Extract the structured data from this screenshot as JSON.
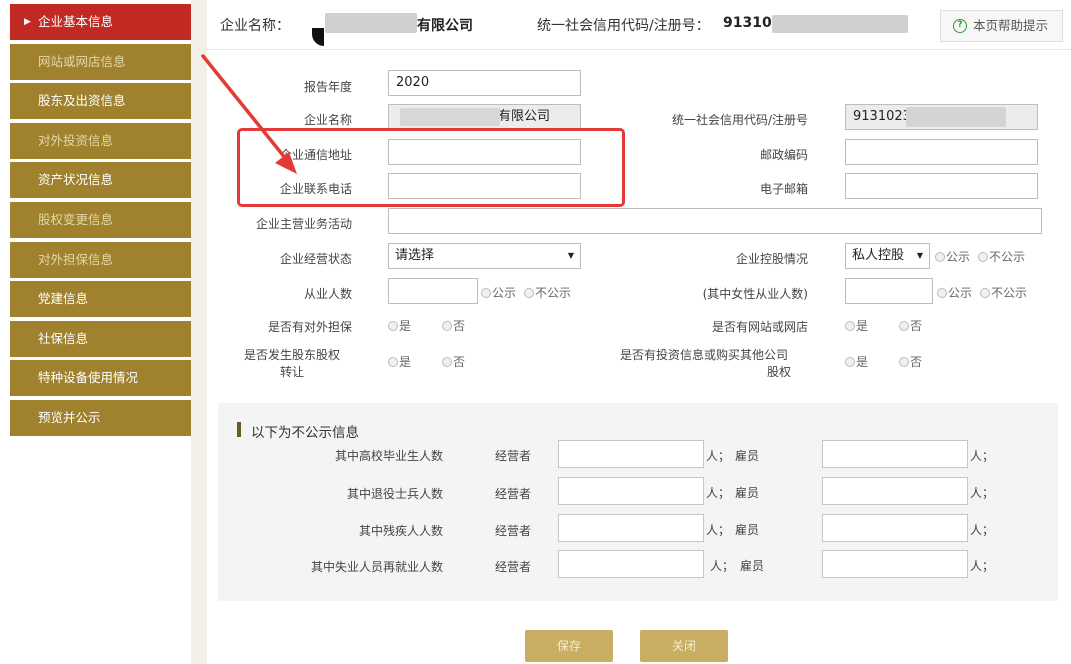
{
  "sidebar": {
    "items": [
      {
        "label": "企业基本信息",
        "state": "active"
      },
      {
        "label": "网站或网店信息",
        "state": "dim"
      },
      {
        "label": "股东及出资信息",
        "state": "normal"
      },
      {
        "label": "对外投资信息",
        "state": "dim"
      },
      {
        "label": "资产状况信息",
        "state": "normal"
      },
      {
        "label": "股权变更信息",
        "state": "dim"
      },
      {
        "label": "对外担保信息",
        "state": "dim"
      },
      {
        "label": "党建信息",
        "state": "normal"
      },
      {
        "label": "社保信息",
        "state": "normal"
      },
      {
        "label": "特种设备使用情况",
        "state": "normal"
      },
      {
        "label": "预览并公示",
        "state": "normal"
      }
    ],
    "active_caret": "▶"
  },
  "header": {
    "company_name_label": "企业名称：",
    "company_name_suffix": "有限公司",
    "credit_code_label": "统一社会信用代码/注册号：",
    "credit_code_prefix": "91310",
    "help_button_label": "本页帮助提示",
    "help_icon_glyph": "?"
  },
  "form": {
    "report_year_label": "报告年度",
    "report_year_value": "2020",
    "company_name_label": "企业名称",
    "company_name_value": "有限公司",
    "credit_code_label": "统一社会信用代码/注册号",
    "credit_code_value": "91310230",
    "address_label": "企业通信地址",
    "postcode_label": "邮政编码",
    "phone_label": "企业联系电话",
    "email_label": "电子邮箱",
    "main_business_label": "企业主营业务活动",
    "operating_status_label": "企业经营状态",
    "operating_status_value": "请选择",
    "holding_label": "企业控股情况",
    "holding_value": "私人控股",
    "employees_label": "从业人数",
    "female_employees_label": "(其中女性从业人数)",
    "public_label": "公示",
    "not_public_label": "不公示",
    "guarantee_label": "是否有对外担保",
    "website_label": "是否有网站或网店",
    "equity_transfer_label_line1": "是否发生股东股权",
    "equity_transfer_label_line2": "转让",
    "investment_label_line1": "是否有投资信息或购买其他公司",
    "investment_label_line2": "股权",
    "yes_label": "是",
    "no_label": "否",
    "select_arrow": "▼"
  },
  "non_public": {
    "title": "以下为不公示信息",
    "operator_label": "经营者",
    "employee_label": "雇员",
    "person_sep": "人；",
    "person_end": "人；",
    "rows": [
      {
        "label": "其中高校毕业生人数"
      },
      {
        "label": "其中退役士兵人数"
      },
      {
        "label": "其中残疾人人数"
      },
      {
        "label": "其中失业人员再就业人数"
      }
    ]
  },
  "buttons": {
    "save_label": "保存",
    "close_label": "关闭"
  },
  "colors": {
    "sidebar": "#a0822e",
    "sidebar_active": "#c12a22",
    "annotation": "#e23a36",
    "button": "#c9ad63"
  }
}
